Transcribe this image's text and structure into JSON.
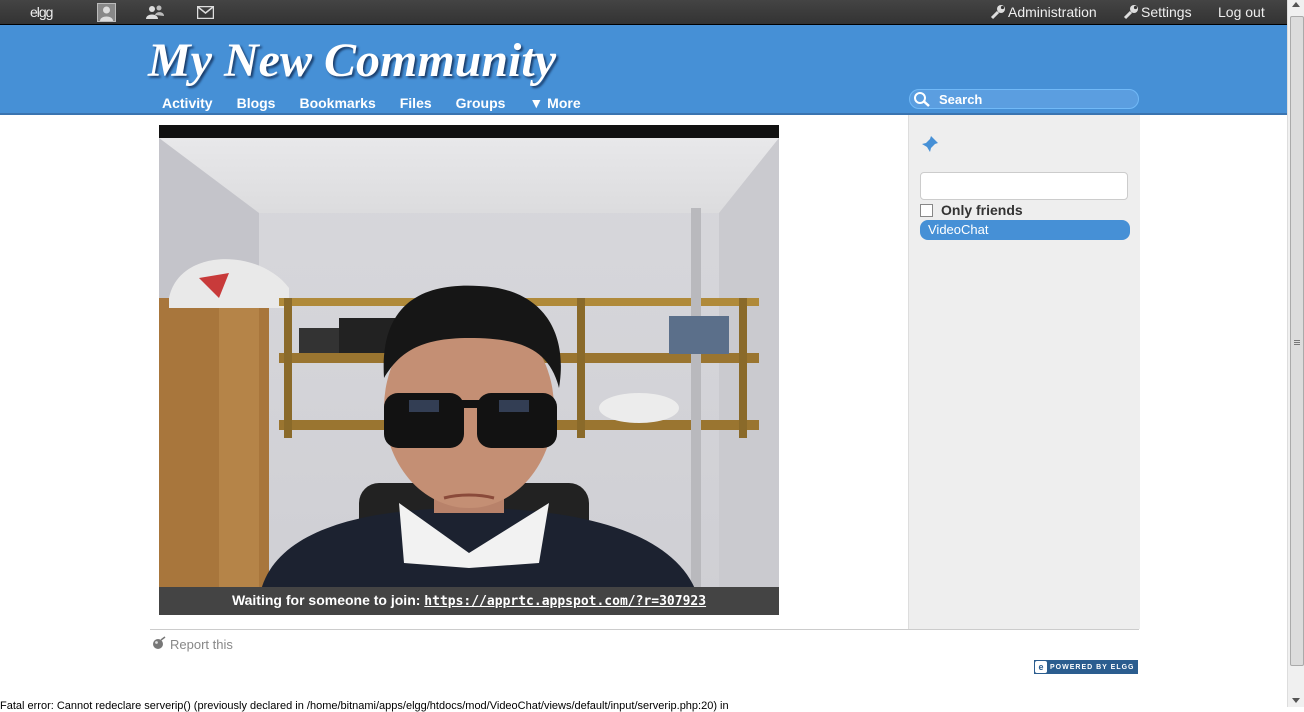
{
  "topbar": {
    "logo": "elgg",
    "admin_label": "Administration",
    "settings_label": "Settings",
    "logout_label": "Log out"
  },
  "header": {
    "site_name": "My New Community",
    "nav": [
      "Activity",
      "Blogs",
      "Bookmarks",
      "Files",
      "Groups"
    ],
    "more_label": "More",
    "search_placeholder": "Search"
  },
  "video": {
    "status_text": "Waiting for someone to join:",
    "room_link": "https://apprtc.appspot.com/?r=307923"
  },
  "sidebar": {
    "only_friends_label": "Only friends",
    "active_item": "VideoChat"
  },
  "footer": {
    "report_label": "Report this",
    "powered_by": "POWERED BY ELGG",
    "error_text": "Fatal error: Cannot redeclare serverip() (previously declared in /home/bitnami/apps/elgg/htdocs/mod/VideoChat/views/default/input/serverip.php:20) in"
  },
  "colors": {
    "header_blue": "#4690d6",
    "topbar": "#333333",
    "sidebar_bg": "#eeeeee"
  }
}
